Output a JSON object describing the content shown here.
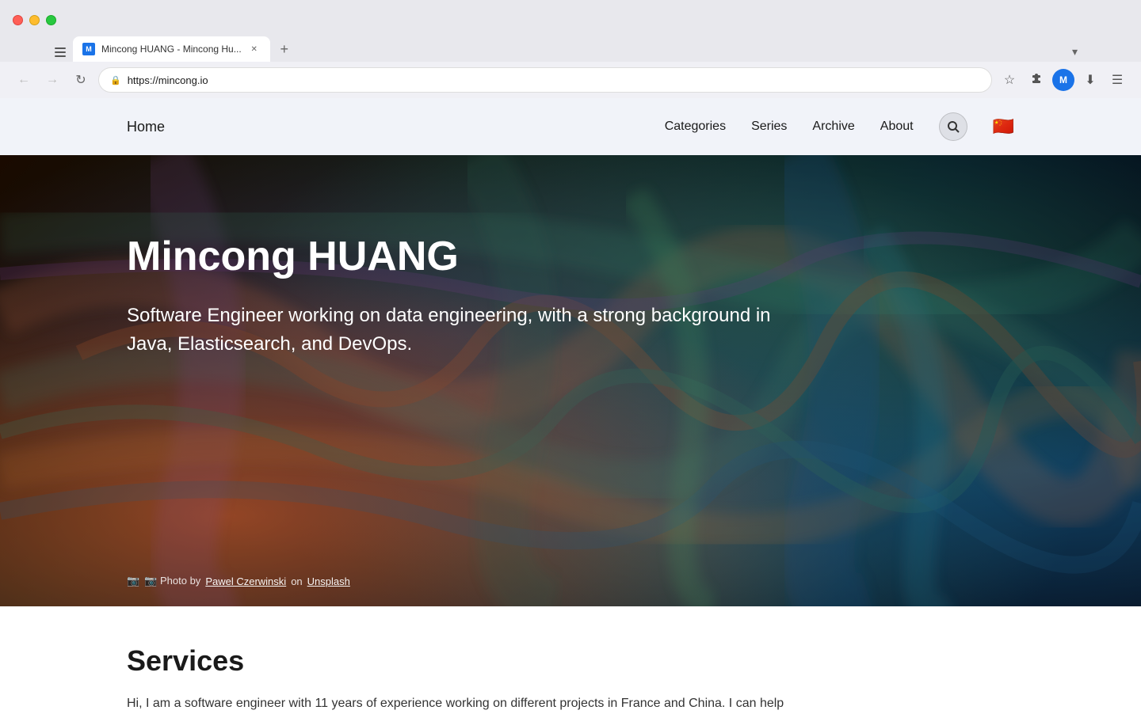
{
  "browser": {
    "tab_title": "Mincong HUANG - Mincong Hu...",
    "tab_favicon_letter": "M",
    "url": "https://mincong.io",
    "tab_list_icon": "▾"
  },
  "nav": {
    "home_label": "Home",
    "categories_label": "Categories",
    "series_label": "Series",
    "archive_label": "Archive",
    "about_label": "About",
    "search_icon": "🔍",
    "flag": "🇨🇳"
  },
  "hero": {
    "title": "Mincong HUANG",
    "subtitle": "Software Engineer working on data engineering, with a strong background in Java, Elasticsearch, and DevOps.",
    "photo_credit_prefix": "📷 Photo by",
    "photographer": "Pawel Czerwinski",
    "photo_on": "on",
    "photo_source": "Unsplash"
  },
  "services": {
    "title": "Services",
    "description": "Hi, I am a software engineer with 11 years of experience working on different projects in France and China. I can help"
  }
}
